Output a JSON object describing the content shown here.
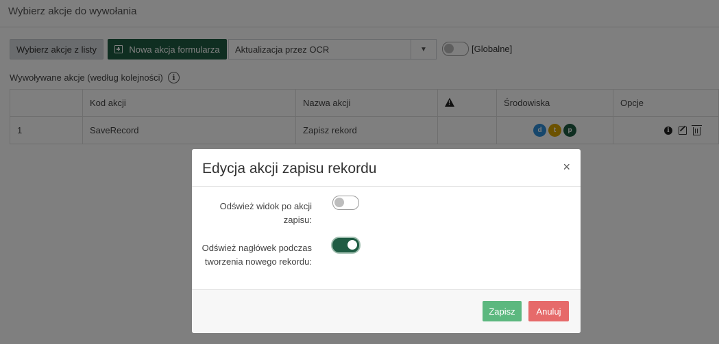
{
  "page": {
    "title": "Wybierz akcje do wywołania"
  },
  "toolbar": {
    "choose_from_list": "Wybierz akcje z listy",
    "new_form_action": "Nowa akcja formularza",
    "selected_action": "Aktualizacja przez OCR",
    "global_toggle_on": false,
    "global_label": "[Globalne]"
  },
  "section": {
    "label": "Wywoływane akcje (według kolejności)"
  },
  "table": {
    "headers": [
      "",
      "Kod akcji",
      "Nazwa akcji",
      "warning-icon",
      "Środowiska",
      "Opcje"
    ],
    "rows": [
      {
        "index": "1",
        "code": "SaveRecord",
        "name": "Zapisz rekord",
        "envs": [
          {
            "letter": "d",
            "color": "#2f8fd8"
          },
          {
            "letter": "t",
            "color": "#d9a400"
          },
          {
            "letter": "p",
            "color": "#1f5c43"
          }
        ]
      }
    ]
  },
  "modal": {
    "title": "Edycja akcji zapisu rekordu",
    "close": "×",
    "fields": [
      {
        "line1": "Odśwież widok po akcji",
        "line2": "zapisu:",
        "on": false
      },
      {
        "line1": "Odśwież nagłówek podczas",
        "line2": "tworzenia nowego rekordu:",
        "on": true
      }
    ],
    "save": "Zapisz",
    "cancel": "Anuluj"
  },
  "colors": {
    "primary_green": "#1f5c43",
    "save_green": "#5cb87f",
    "cancel_red": "#e66a6a"
  }
}
